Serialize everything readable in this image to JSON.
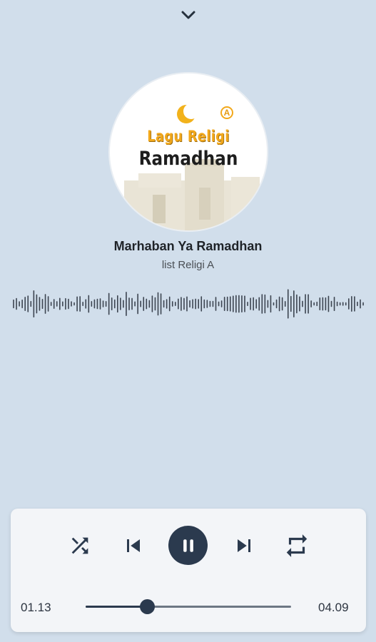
{
  "header": {
    "collapse_icon": "chevron-down-icon"
  },
  "album_art": {
    "line1": "Lagu Religi",
    "line2": "Ramadhan",
    "badge": "A",
    "moon_icon": "crescent-moon-icon"
  },
  "track": {
    "title": "Marhaban Ya Ramadhan",
    "subtitle": "list Religi A"
  },
  "controls": {
    "shuffle_icon": "shuffle-icon",
    "previous_icon": "skip-previous-icon",
    "play_pause_icon": "pause-icon",
    "next_icon": "skip-next-icon",
    "repeat_icon": "repeat-icon"
  },
  "progress": {
    "current_time": "01.13",
    "total_time": "04.09",
    "fraction": 0.297
  },
  "colors": {
    "background": "#d1deeb",
    "accent": "#2b3a4e",
    "panel": "#f3f5f8",
    "art_gold": "#f2a81b"
  }
}
